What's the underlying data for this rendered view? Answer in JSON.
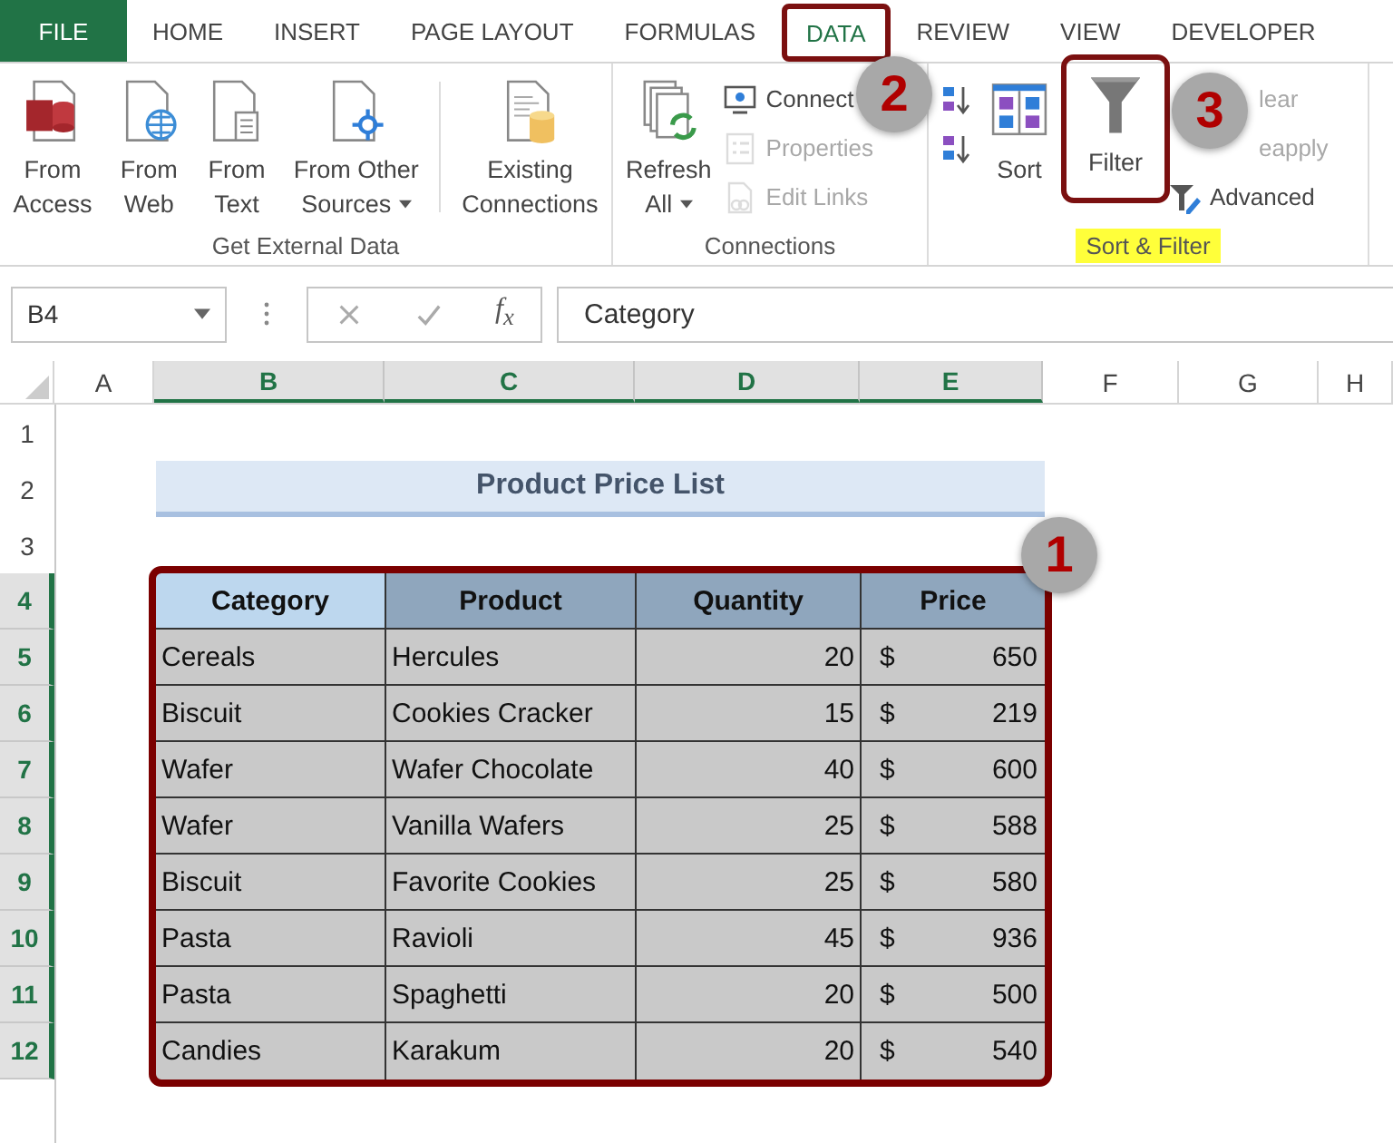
{
  "tabs": [
    {
      "label": "FILE",
      "kind": "file",
      "selected": false,
      "annotated": false
    },
    {
      "label": "HOME",
      "kind": "tab",
      "selected": false,
      "annotated": false
    },
    {
      "label": "INSERT",
      "kind": "tab",
      "selected": false,
      "annotated": false
    },
    {
      "label": "PAGE LAYOUT",
      "kind": "tab",
      "selected": false,
      "annotated": false
    },
    {
      "label": "FORMULAS",
      "kind": "tab",
      "selected": false,
      "annotated": false
    },
    {
      "label": "DATA",
      "kind": "tab",
      "selected": true,
      "annotated": true
    },
    {
      "label": "REVIEW",
      "kind": "tab",
      "selected": false,
      "annotated": false
    },
    {
      "label": "VIEW",
      "kind": "tab",
      "selected": false,
      "annotated": false
    },
    {
      "label": "DEVELOPER",
      "kind": "tab",
      "selected": false,
      "annotated": false
    }
  ],
  "ribbon": {
    "groups": [
      {
        "label": "Get External Data",
        "highlighted": false,
        "columns": [
          {
            "kind": "large",
            "lines": [
              "From",
              "Access"
            ],
            "dropdown": false,
            "annotated": false
          },
          {
            "kind": "large",
            "lines": [
              "From",
              "Web"
            ],
            "dropdown": false,
            "annotated": false
          },
          {
            "kind": "large",
            "lines": [
              "From",
              "Text"
            ],
            "dropdown": false,
            "annotated": false
          },
          {
            "kind": "large",
            "lines": [
              "From Other",
              "Sources"
            ],
            "dropdown": true,
            "annotated": false
          },
          {
            "kind": "separator"
          },
          {
            "kind": "large",
            "lines": [
              "Existing",
              "Connections"
            ],
            "dropdown": false,
            "annotated": false
          }
        ]
      },
      {
        "label": "Connections",
        "highlighted": false,
        "columns": [
          {
            "kind": "large",
            "lines": [
              "Refresh",
              "All"
            ],
            "dropdown": true,
            "annotated": false
          },
          {
            "kind": "stack",
            "items": [
              {
                "label": "Connect",
                "disabled": false
              },
              {
                "label": "Properties",
                "disabled": true
              },
              {
                "label": "Edit Links",
                "disabled": true
              }
            ]
          }
        ]
      },
      {
        "label": "Sort & Filter",
        "highlighted": true,
        "columns": [
          {
            "kind": "stack",
            "items": [
              {
                "disabled": false
              },
              {
                "disabled": false
              }
            ]
          },
          {
            "kind": "large",
            "lines": [
              "Sort"
            ],
            "dropdown": false,
            "annotated": false
          },
          {
            "kind": "large",
            "lines": [
              "Filter"
            ],
            "dropdown": false,
            "annotated": true
          },
          {
            "kind": "stack",
            "items": [
              {
                "label": "lear",
                "disabled": true
              },
              {
                "label": "eapply",
                "disabled": true
              },
              {
                "label": "Advanced",
                "disabled": false
              }
            ]
          }
        ]
      }
    ]
  },
  "name_box": "B4",
  "function_label": "f$_{x}$",
  "formula": "Category",
  "columns": [
    {
      "label": "A",
      "selected": false
    },
    {
      "label": "B",
      "selected": true
    },
    {
      "label": "C",
      "selected": true
    },
    {
      "label": "D",
      "selected": true
    },
    {
      "label": "E",
      "selected": true
    },
    {
      "label": "F",
      "selected": false
    },
    {
      "label": "G",
      "selected": false
    },
    {
      "label": "H",
      "selected": false
    }
  ],
  "rows": [
    {
      "label": "1",
      "selected": false
    },
    {
      "label": "2",
      "selected": false
    },
    {
      "label": "3",
      "selected": false
    },
    {
      "label": "4",
      "selected": true
    },
    {
      "label": "5",
      "selected": true
    },
    {
      "label": "6",
      "selected": true
    },
    {
      "label": "7",
      "selected": true
    },
    {
      "label": "8",
      "selected": true
    },
    {
      "label": "9",
      "selected": true
    },
    {
      "label": "10",
      "selected": true
    },
    {
      "label": "11",
      "selected": true
    },
    {
      "label": "12",
      "selected": true
    }
  ],
  "title": "Product Price List",
  "table": {
    "headers": [
      {
        "label": "Category",
        "selected": true
      },
      {
        "label": "Product",
        "selected": false
      },
      {
        "label": "Quantity",
        "selected": false
      },
      {
        "label": "Price",
        "selected": false
      }
    ],
    "records": [
      {
        "category": "Cereals",
        "product": "Hercules",
        "quantity": "20",
        "currency": "$",
        "price": "650"
      },
      {
        "category": "Biscuit",
        "product": "Cookies Cracker",
        "quantity": "15",
        "currency": "$",
        "price": "219"
      },
      {
        "category": "Wafer",
        "product": "Wafer Chocolate",
        "quantity": "40",
        "currency": "$",
        "price": "600"
      },
      {
        "category": "Wafer",
        "product": "Vanilla Wafers",
        "quantity": "25",
        "currency": "$",
        "price": "588"
      },
      {
        "category": "Biscuit",
        "product": "Favorite Cookies",
        "quantity": "25",
        "currency": "$",
        "price": "580"
      },
      {
        "category": "Pasta",
        "product": "Ravioli",
        "quantity": "45",
        "currency": "$",
        "price": "936"
      },
      {
        "category": "Pasta",
        "product": "Spaghetti",
        "quantity": "20",
        "currency": "$",
        "price": "500"
      },
      {
        "category": "Candies",
        "product": "Karakum",
        "quantity": "20",
        "currency": "$",
        "price": "540"
      }
    ]
  },
  "callouts": [
    {
      "label": "1"
    },
    {
      "label": "2"
    },
    {
      "label": "3"
    }
  ]
}
